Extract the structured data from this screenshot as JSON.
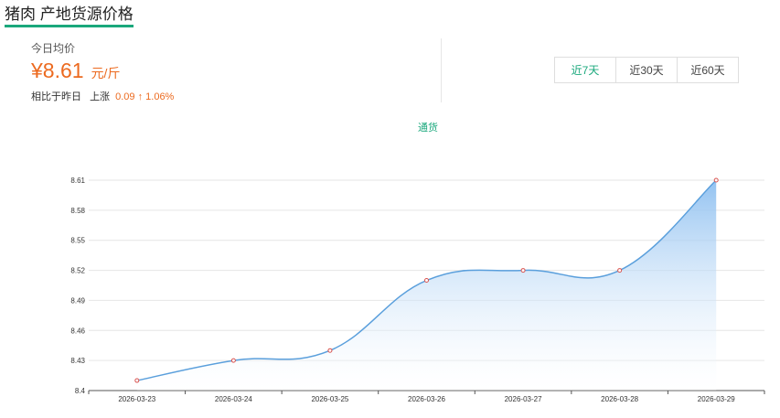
{
  "header": {
    "title": "猪肉 产地货源价格"
  },
  "summary": {
    "today_label": "今日均价",
    "price": "¥8.61",
    "unit": "元/斤",
    "compare_prefix": "相比于昨日",
    "trend_label": "上涨",
    "change": "0.09 ↑ 1.06%"
  },
  "range_tabs": [
    "近7天",
    "近30天",
    "近60天"
  ],
  "active_tab": 0,
  "colors": {
    "accent": "#1aa87c",
    "price": "#ec6a1f",
    "line": "#5a9fdc",
    "area_top": "#8dbff0",
    "point": "#d9534f"
  },
  "chart_data": {
    "type": "area",
    "legend": "通货",
    "x": [
      "2026-03-23",
      "2026-03-24",
      "2026-03-25",
      "2026-03-26",
      "2026-03-27",
      "2026-03-28",
      "2026-03-29"
    ],
    "series": [
      {
        "name": "通货",
        "values": [
          8.41,
          8.43,
          8.44,
          8.51,
          8.52,
          8.52,
          8.61
        ]
      }
    ],
    "ylim": [
      8.4,
      8.61
    ],
    "yticks": [
      8.4,
      8.43,
      8.46,
      8.49,
      8.52,
      8.55,
      8.58,
      8.61
    ],
    "grid": true,
    "smooth": true
  }
}
